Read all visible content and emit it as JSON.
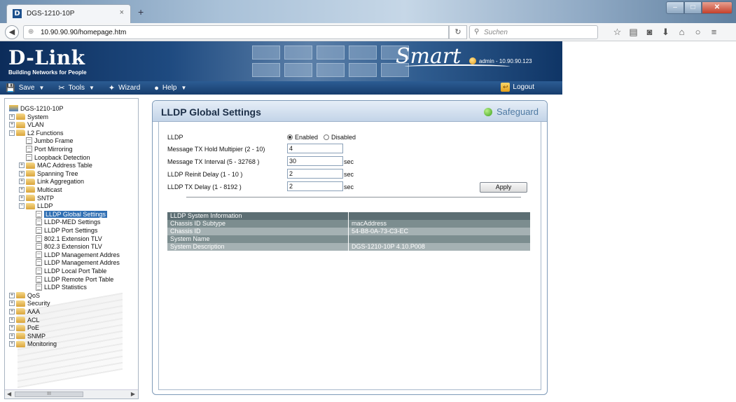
{
  "browser": {
    "tab_title": "DGS-1210-10P",
    "tab_close": "×",
    "new_tab": "+",
    "favicon_letter": "D",
    "url": "10.90.90.90/homepage.htm",
    "search_placeholder": "Suchen",
    "icons": [
      "star-icon",
      "reading-list-icon",
      "pocket-icon",
      "download-icon",
      "home-icon",
      "chat-icon",
      "menu-icon"
    ]
  },
  "header": {
    "logo": "D-Link",
    "tagline": "Building Networks for People",
    "smart": "Smart",
    "admin": "admin - 10.90.90.123"
  },
  "menu": {
    "items": [
      {
        "label": "Save",
        "icon": "save-icon"
      },
      {
        "label": "Tools",
        "icon": "tools-icon"
      },
      {
        "label": "Wizard",
        "icon": "wizard-icon"
      },
      {
        "label": "Help",
        "icon": "help-icon"
      }
    ],
    "logout": "Logout"
  },
  "tree": {
    "root": "DGS-1210-10P",
    "nodes": [
      {
        "label": "System",
        "type": "folder",
        "level": 1,
        "expand": "+"
      },
      {
        "label": "VLAN",
        "type": "folder",
        "level": 1,
        "expand": "+"
      },
      {
        "label": "L2 Functions",
        "type": "folder",
        "level": 1,
        "expand": "−"
      },
      {
        "label": "Jumbo Frame",
        "type": "doc",
        "level": 2
      },
      {
        "label": "Port Mirroring",
        "type": "doc",
        "level": 2
      },
      {
        "label": "Loopback Detection",
        "type": "doc",
        "level": 2
      },
      {
        "label": "MAC Address Table",
        "type": "folder",
        "level": 2,
        "expand": "+"
      },
      {
        "label": "Spanning Tree",
        "type": "folder",
        "level": 2,
        "expand": "+"
      },
      {
        "label": "Link Aggregation",
        "type": "folder",
        "level": 2,
        "expand": "+"
      },
      {
        "label": "Multicast",
        "type": "folder",
        "level": 2,
        "expand": "+"
      },
      {
        "label": "SNTP",
        "type": "folder",
        "level": 2,
        "expand": "+"
      },
      {
        "label": "LLDP",
        "type": "folder",
        "level": 2,
        "expand": "−"
      },
      {
        "label": "LLDP Global Settings",
        "type": "doc",
        "level": 3,
        "selected": true
      },
      {
        "label": "LLDP-MED Settings",
        "type": "doc",
        "level": 3
      },
      {
        "label": "LLDP Port Settings",
        "type": "doc",
        "level": 3
      },
      {
        "label": "802.1 Extension TLV",
        "type": "doc",
        "level": 3
      },
      {
        "label": "802.3 Extension TLV",
        "type": "doc",
        "level": 3
      },
      {
        "label": "LLDP Management Addres",
        "type": "doc",
        "level": 3
      },
      {
        "label": "LLDP Management Addres",
        "type": "doc",
        "level": 3
      },
      {
        "label": "LLDP Local Port Table",
        "type": "doc",
        "level": 3
      },
      {
        "label": "LLDP Remote Port Table",
        "type": "doc",
        "level": 3
      },
      {
        "label": "LLDP Statistics",
        "type": "doc",
        "level": 3
      },
      {
        "label": "QoS",
        "type": "folder",
        "level": 1,
        "expand": "+"
      },
      {
        "label": "Security",
        "type": "folder",
        "level": 1,
        "expand": "+"
      },
      {
        "label": "AAA",
        "type": "folder",
        "level": 1,
        "expand": "+"
      },
      {
        "label": "ACL",
        "type": "folder",
        "level": 1,
        "expand": "+"
      },
      {
        "label": "PoE",
        "type": "folder",
        "level": 1,
        "expand": "+"
      },
      {
        "label": "SNMP",
        "type": "folder",
        "level": 1,
        "expand": "+"
      },
      {
        "label": "Monitoring",
        "type": "folder",
        "level": 1,
        "expand": "+"
      }
    ],
    "scroll_thumb": "III"
  },
  "panel": {
    "title": "LLDP Global Settings",
    "safeguard": "Safeguard",
    "lldp_label": "LLDP",
    "enabled": "Enabled",
    "disabled": "Disabled",
    "fields": [
      {
        "label": "Message TX Hold Multipier (2 - 10)",
        "value": "4",
        "unit": ""
      },
      {
        "label": "Message TX Interval (5 - 32768 )",
        "value": "30",
        "unit": "sec"
      },
      {
        "label": "LLDP Reinit Delay (1 - 10 )",
        "value": "2",
        "unit": "sec"
      },
      {
        "label": "LLDP TX Delay (1 - 8192 )",
        "value": "2",
        "unit": "sec"
      }
    ],
    "apply": "Apply",
    "info_title": "LLDP System Information",
    "info_rows": [
      {
        "name": "Chassis ID Subtype",
        "value": "macAddress"
      },
      {
        "name": "Chassis ID",
        "value": "54-B8-0A-73-C3-EC"
      },
      {
        "name": "System Name",
        "value": ""
      },
      {
        "name": "System Description",
        "value": "DGS-1210-10P 4.10.P008"
      }
    ]
  },
  "colors": {
    "header_dark": "#0c2c5a",
    "menu_blue": "#2c5c93",
    "selected": "#2f6fb3",
    "safeguard_green": "#3da01a",
    "info_head": "#5c6e73"
  }
}
